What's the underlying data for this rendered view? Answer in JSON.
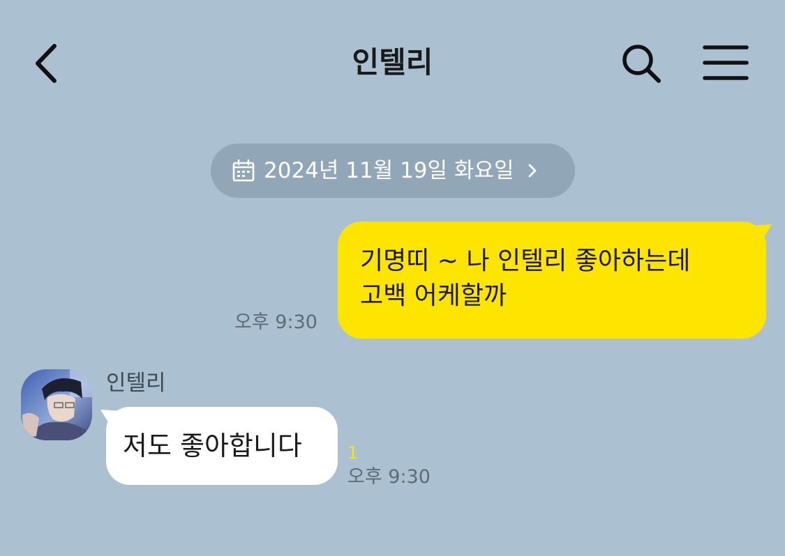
{
  "header": {
    "title": "인텔리",
    "back_icon": "chevron-left-icon",
    "search_icon": "search-icon",
    "menu_icon": "hamburger-menu-icon"
  },
  "date_divider": {
    "text": "2024년 11월 19일 화요일",
    "icon": "calendar-icon",
    "chevron": "chevron-right-icon"
  },
  "messages": [
    {
      "direction": "outgoing",
      "lines": [
        "기명띠 ~ 나 인텔리 좋아하는데",
        "고백 어케할까"
      ],
      "time": "오후 9:30"
    },
    {
      "direction": "incoming",
      "sender": "인텔리",
      "text": "저도 좋아합니다",
      "unread_count": "1",
      "time": "오후 9:30"
    }
  ],
  "colors": {
    "background": "#abc1d2",
    "outgoing_bubble": "#fee500",
    "incoming_bubble": "#ffffff",
    "date_pill": "#91a6b6",
    "unread": "#fee500"
  }
}
